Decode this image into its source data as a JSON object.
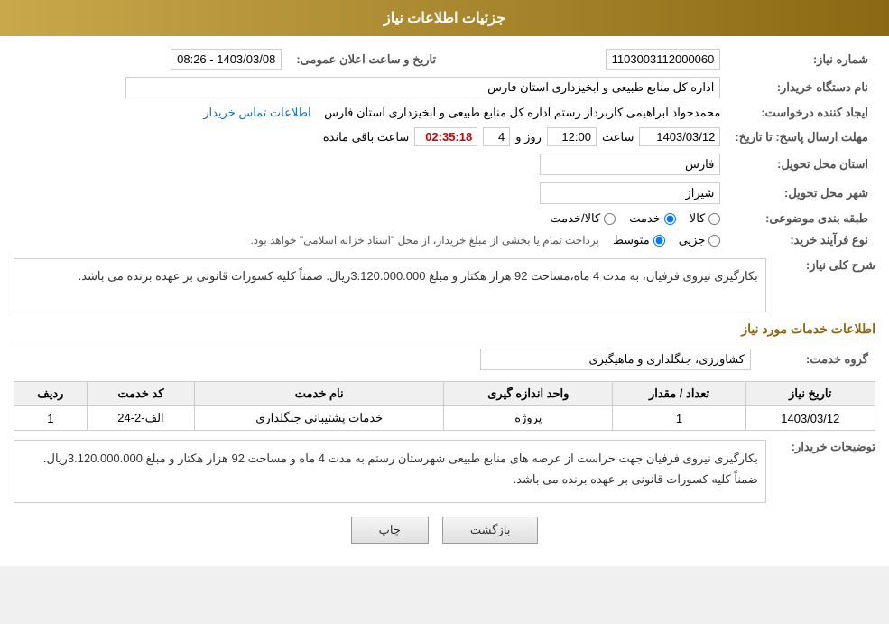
{
  "header": {
    "title": "جزئیات اطلاعات نیاز"
  },
  "fields": {
    "shomare_niaz_label": "شماره نیاز:",
    "shomare_niaz_value": "1103003112000060",
    "dastgah_label": "نام دستگاه خریدار:",
    "dastgah_value": "اداره کل منابع طبیعی و ابخیزداری استان فارس",
    "idad_label": "ایجاد کننده درخواست:",
    "idad_contact": "اطلاعات تماس خریدار",
    "idad_value": "محمدجواد ابراهیمی کاربرداز رستم اداره کل منابع طبیعی و ابخیزداری استان فارس",
    "mohlat_label": "مهلت ارسال پاسخ: تا تاریخ:",
    "mohlat_date": "1403/03/12",
    "mohlat_saat_label": "ساعت",
    "mohlat_saat_value": "12:00",
    "mohlat_rooz_label": "روز و",
    "mohlat_rooz_value": "4",
    "mohlat_mande_label": "ساعت باقی مانده",
    "mohlat_timer": "02:35:18",
    "ostan_label": "استان محل تحویل:",
    "ostan_value": "فارس",
    "shahr_label": "شهر محل تحویل:",
    "shahr_value": "شیراز",
    "tabaqe_label": "طبقه بندی موضوعی:",
    "tabaqe_kala": "کالا",
    "tabaqe_khadamat": "خدمت",
    "tabaqe_kala_khadamat": "کالا/خدمت",
    "farayand_label": "نوع فرآیند خرید:",
    "farayand_jozii": "جزیی",
    "farayand_motavaset": "متوسط",
    "farayand_note": "پرداخت تمام یا بخشی از مبلغ خریدار، از محل \"اسناد خزانه اسلامی\" خواهد بود.",
    "sharh_label": "شرح کلی نیاز:",
    "sharh_value": "بکارگیری نیروی فرفیان،  به مدت 4 ماه،مساحت 92 هزار هکتار و مبلغ 3.120.000.000ریال. ضمناً کلیه کسورات قانونی بر عهده برنده می باشد.",
    "khadamat_title": "اطلاعات خدمات مورد نیاز",
    "grouh_label": "گروه خدمت:",
    "grouh_value": "کشاورزی، جنگلداری و ماهیگیری",
    "table_headers": {
      "radif": "ردیف",
      "kod": "کد خدمت",
      "naam": "نام خدمت",
      "vahed": "واحد اندازه گیری",
      "tedad": "تعداد / مقدار",
      "tarikh": "تاریخ نیاز"
    },
    "table_rows": [
      {
        "radif": "1",
        "kod": "الف-2-24",
        "naam": "خدمات پشتیبانی جنگلداری",
        "vahed": "پروژه",
        "tedad": "1",
        "tarikh": "1403/03/12"
      }
    ],
    "notes_label": "توضیحات خریدار:",
    "notes_value": "بکارگیری نیروی فرفیان جهت حراست از عرصه های منابع طبیعی شهرستان رستم  به مدت 4 ماه و مساحت 92 هزار هکتار و مبلغ 3.120.000.000ریال. ضمناً کلیه کسورات قانونی بر عهده برنده می باشد.",
    "btn_print": "چاپ",
    "btn_back": "بازگشت",
    "tarikh_elan_label": "تاریخ و ساعت اعلان عمومی:",
    "tarikh_elan_value": "1403/03/08 - 08:26"
  }
}
